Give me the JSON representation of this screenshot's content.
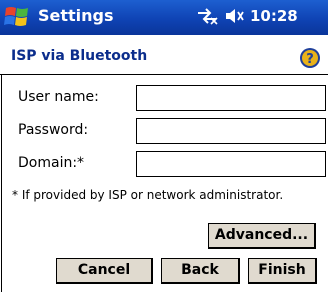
{
  "titlebar": {
    "app_title": "Settings",
    "clock": "10:28",
    "icons": [
      "windows-start-icon",
      "connectivity-icon",
      "volume-icon"
    ]
  },
  "page": {
    "title": "ISP via Bluetooth",
    "help_icon": "help-icon"
  },
  "form": {
    "username": {
      "label": "User name:",
      "value": ""
    },
    "password": {
      "label": "Password:",
      "value": ""
    },
    "domain": {
      "label": "Domain:*",
      "value": ""
    },
    "note": "* If provided by ISP or network administrator."
  },
  "buttons": {
    "advanced": "Advanced...",
    "cancel": "Cancel",
    "back": "Back",
    "finish": "Finish"
  },
  "colors": {
    "titlebar": "#0f43b4",
    "page_title": "#0b2d8c",
    "button_face": "#e0dacf"
  }
}
